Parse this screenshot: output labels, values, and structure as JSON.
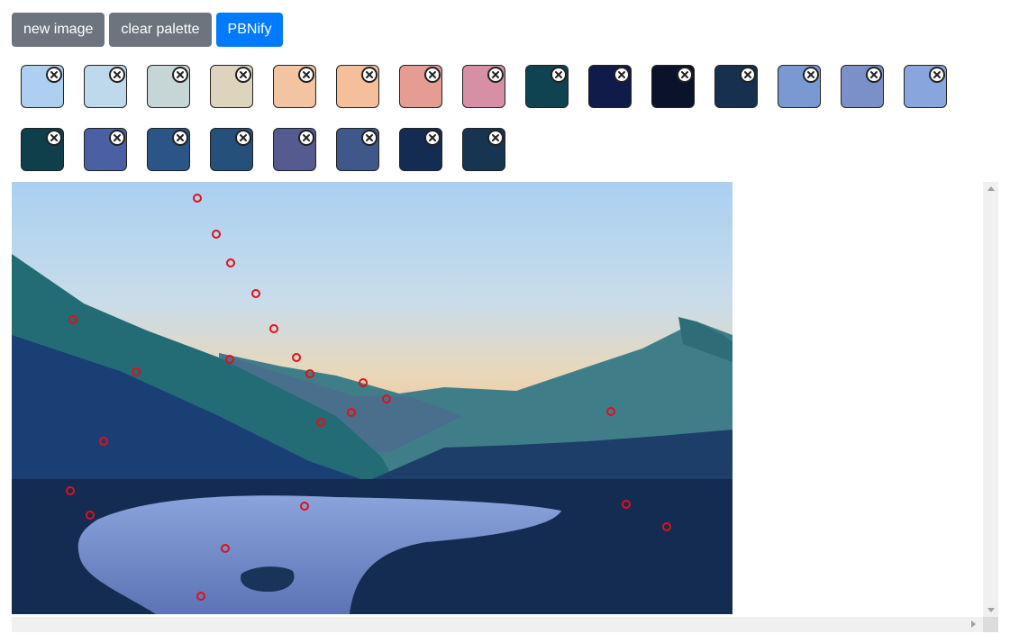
{
  "toolbar": {
    "new_image_label": "new image",
    "clear_palette_label": "clear palette",
    "pbnify_label": "PBNify"
  },
  "palette": {
    "colors": [
      "#aecfef",
      "#bed8ec",
      "#c6d6d6",
      "#ded3bd",
      "#f2c4a1",
      "#f6bf9c",
      "#e49c93",
      "#d78fa6",
      "#0f4352",
      "#111b4a",
      "#0b132b",
      "#17304f",
      "#7a98d2",
      "#7b8fc9",
      "#88a5dd",
      "#0f3f4a",
      "#4a60a2",
      "#2a5586",
      "#245079",
      "#555b8e",
      "#40578a",
      "#152c52",
      "#173550"
    ],
    "remove_icon": "close-circle-icon"
  },
  "canvas": {
    "marker_color": "#e0101a"
  }
}
